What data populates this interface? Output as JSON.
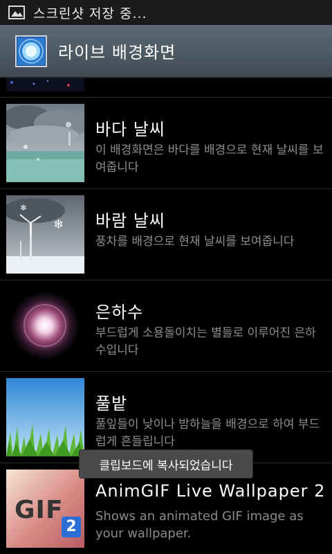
{
  "status_bar": {
    "notification_text": "스크린샷 저장 중...",
    "icon": "image-icon"
  },
  "title_bar": {
    "title": "라이브 배경화면",
    "icon": "live-wallpaper-app-icon"
  },
  "wallpapers": [
    {
      "title": "바다 날씨",
      "description": "이 배경화면은 바다를 배경으로 현재 날씨를 보여줍니다",
      "thumbnail": "sea-weather-thumbnail"
    },
    {
      "title": "바람 날씨",
      "description": "풍차를 배경으로 현재 날씨를 보여줍니다",
      "thumbnail": "wind-weather-thumbnail"
    },
    {
      "title": "은하수",
      "description": "부드럽게 소용돌이치는 별들로 이루어진 은하수입니다",
      "thumbnail": "galaxy-thumbnail"
    },
    {
      "title": "풀밭",
      "description": "풀잎들이 낮이나 밤하늘을 배경으로 하여 부드럽게 흔들립니다",
      "thumbnail": "grass-thumbnail"
    },
    {
      "title": "AnimGIF Live Wallpaper 2",
      "description": "Shows an animated GIF image as your wallpaper.",
      "thumbnail": "animgif-thumbnail",
      "thumbnail_text": "GIF",
      "thumbnail_badge": "2"
    }
  ],
  "toast": {
    "text": "클립보드에 복사되었습니다"
  },
  "colors": {
    "background": "#000000",
    "title_bar": "#4f5b66",
    "description_text": "#8e8e8e",
    "toast_bg": "#4a4a4a"
  }
}
